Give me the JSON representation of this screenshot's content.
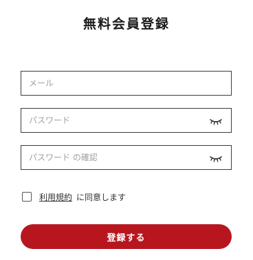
{
  "page": {
    "title": "無料会員登録"
  },
  "form": {
    "email": {
      "placeholder": "メール",
      "value": ""
    },
    "password": {
      "placeholder": "パスワード",
      "value": "",
      "toggle_icon": "eye-closed-icon"
    },
    "password_confirm": {
      "placeholder": "パスワード の確認",
      "value": "",
      "toggle_icon": "eye-closed-icon"
    },
    "terms": {
      "checked": false,
      "link_label": "利用規約",
      "suffix": "に同意します"
    },
    "submit_label": "登録する"
  },
  "colors": {
    "accent": "#b8161e",
    "border": "#3a3a3a",
    "placeholder": "#a0a0a0"
  }
}
